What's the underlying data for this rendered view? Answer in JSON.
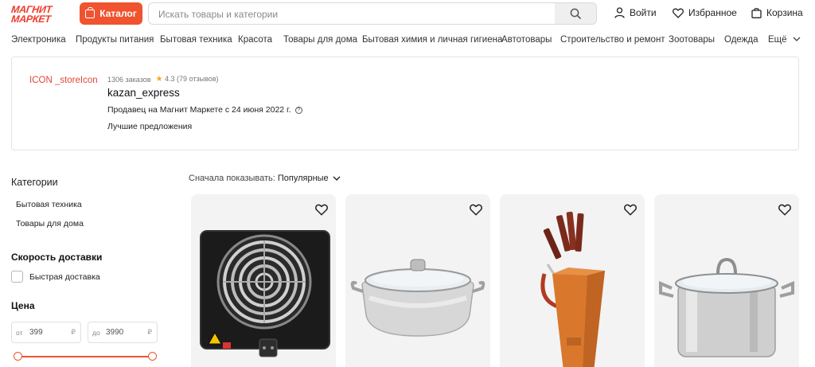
{
  "header": {
    "logo_line1": "МАГНИТ",
    "logo_line2": "МАРКЕТ",
    "catalog_label": "Каталог",
    "search_placeholder": "Искать товары и категории",
    "login_label": "Войти",
    "favorites_label": "Избранное",
    "cart_label": "Корзина"
  },
  "nav": {
    "items": [
      "Электроника",
      "Продукты питания",
      "Бытовая техника",
      "Красота",
      "Товары для дома",
      "Бытовая химия и личная гигиена",
      "Автотовары",
      "Строительство и ремонт",
      "Зоотовары",
      "Одежда",
      "Ещё"
    ]
  },
  "seller": {
    "store_icon": "ICON _storeIcon",
    "orders": "1306 заказов",
    "rating": "4.3",
    "reviews": "(79 отзывов)",
    "name": "kazan_express",
    "since": "Продавец на Магнит Маркете с 24 июня 2022 г.",
    "best_offers": "Лучшие предложения"
  },
  "sidebar": {
    "categories_title": "Категории",
    "categories": [
      "Бытовая техника",
      "Товары для дома"
    ],
    "delivery_title": "Скорость доставки",
    "fast_delivery": "Быстрая доставка",
    "price_title": "Цена",
    "price_from_prefix": "от",
    "price_from": "399",
    "price_to_prefix": "до",
    "price_to": "3990",
    "currency": "₽"
  },
  "sort": {
    "label": "Сначала показывать:",
    "value": "Популярные"
  },
  "products": [
    {
      "image": "electric-hotplate"
    },
    {
      "image": "steel-pot-glass-lid"
    },
    {
      "image": "knife-set-with-block"
    },
    {
      "image": "tall-steel-pot"
    }
  ],
  "colors": {
    "accent": "#f0532f",
    "brand": "#ef3b2c",
    "card_bg": "#f3f3f3",
    "star": "#f6a723"
  }
}
